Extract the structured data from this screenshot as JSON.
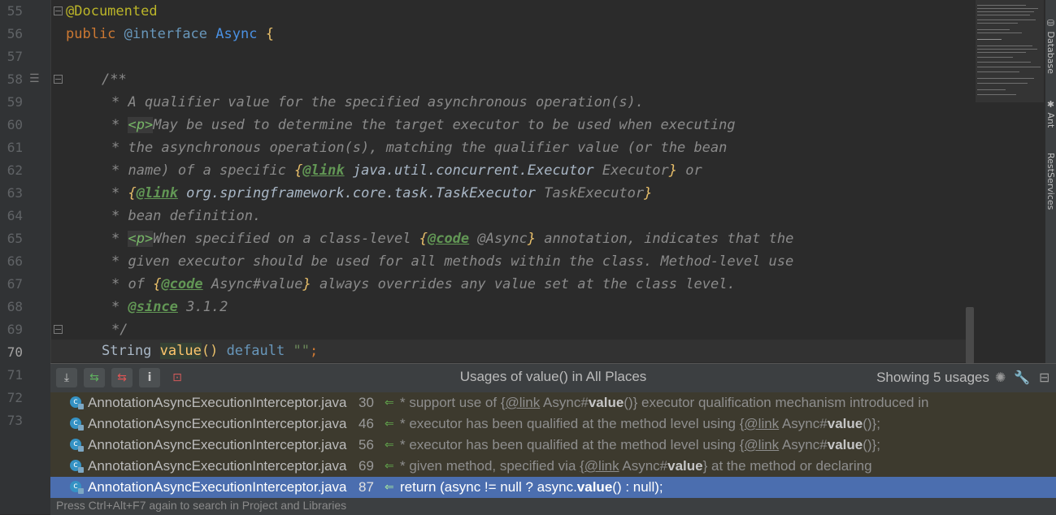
{
  "editor": {
    "line_numbers": [
      "55",
      "56",
      "57",
      "58",
      "59",
      "60",
      "61",
      "62",
      "63",
      "64",
      "65",
      "66",
      "67",
      "68",
      "69",
      "70",
      "71",
      "72",
      "73"
    ],
    "current_line": "70",
    "code": {
      "l55_ann": "@Documented",
      "l56_public": "public",
      "l56_interface": "@interface",
      "l56_name": "Async",
      "l56_brace": "{",
      "l58": "/**",
      "l59": "* A qualifier value for the specified asynchronous operation(s).",
      "l60_star": "* ",
      "l60_p": "<p>",
      "l60_text": "May be used to determine the target executor to be used when executing",
      "l61": "* the asynchronous operation(s), matching the qualifier value (or the bean",
      "l62_a": "* name) of a specific ",
      "l62_ob": "{",
      "l62_tag": "@link",
      "l62_ref": " java.util.concurrent.Executor",
      "l62_lbl": " Executor",
      "l62_cb": "}",
      "l62_end": " or",
      "l63_a": "* ",
      "l63_ob": "{",
      "l63_tag": "@link",
      "l63_ref": " org.springframework.core.task.TaskExecutor",
      "l63_lbl": " TaskExecutor",
      "l63_cb": "}",
      "l64": "* bean definition.",
      "l65_star": "* ",
      "l65_p": "<p>",
      "l65_a": "When specified on a class-level ",
      "l65_ob": "{",
      "l65_tag": "@code",
      "l65_lbl": " @Async",
      "l65_cb": "}",
      "l65_end": " annotation, indicates that the",
      "l66": "* given executor should be used for all methods within the class. Method-level use",
      "l67_a": "* of ",
      "l67_ob": "{",
      "l67_tag": "@code",
      "l67_lbl": " Async#value",
      "l67_cb": "}",
      "l67_end": " always overrides any value set at the class level.",
      "l68_a": "* ",
      "l68_tag": "@since",
      "l68_end": " 3.1.2",
      "l69": "*/",
      "l70_type": "String ",
      "l70_name": "value",
      "l70_paren": "()",
      "l70_default": " default",
      "l70_str": " \"\"",
      "l70_semi": ";"
    }
  },
  "right_tools": [
    "Database",
    "Ant",
    "RestServices"
  ],
  "usages_popup": {
    "title": "Usages of value() in All Places",
    "count": "Showing 5 usages",
    "rows": [
      {
        "file": "AnnotationAsyncExecutionInterceptor.java",
        "line": "30",
        "pre": "* support use of ",
        "link": "{@link",
        "mid": " Async#",
        "bold": "value",
        "post": "()} executor qualification mechanism introduced in"
      },
      {
        "file": "AnnotationAsyncExecutionInterceptor.java",
        "line": "46",
        "pre": "* executor has been qualified at the method level using ",
        "link": "{@link",
        "mid": " Async#",
        "bold": "value",
        "post": "()};"
      },
      {
        "file": "AnnotationAsyncExecutionInterceptor.java",
        "line": "56",
        "pre": "* executor has been qualified at the method level using ",
        "link": "{@link",
        "mid": " Async#",
        "bold": "value",
        "post": "()};"
      },
      {
        "file": "AnnotationAsyncExecutionInterceptor.java",
        "line": "69",
        "pre": "* given method, specified via ",
        "link": "{@link",
        "mid": " Async#",
        "bold": "value",
        "post": "} at the method or declaring"
      },
      {
        "file": "AnnotationAsyncExecutionInterceptor.java",
        "line": "87",
        "pre": "return (async != null ? async.",
        "link": "",
        "mid": "",
        "bold": "value",
        "post": "() : null);"
      }
    ],
    "hint": "Press Ctrl+Alt+F7 again to search in Project and Libraries"
  }
}
